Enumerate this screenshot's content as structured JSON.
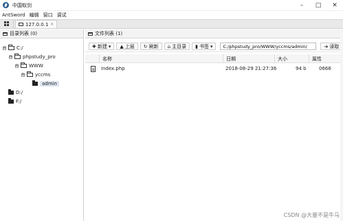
{
  "window": {
    "title": "中国蚁剑"
  },
  "menu": [
    "AntSword",
    "编辑",
    "窗口",
    "调试"
  ],
  "tabs": {
    "session_label": "127.0.0.1"
  },
  "left": {
    "header": "目录列表 (0)",
    "tree": [
      {
        "label": "C:/",
        "toggle": "⊟",
        "indent": 0
      },
      {
        "label": "phpstudy_pro",
        "toggle": "⊟",
        "indent": 1
      },
      {
        "label": "WWW",
        "toggle": "⊟",
        "indent": 2
      },
      {
        "label": "yccms",
        "toggle": "⊟",
        "indent": 3
      },
      {
        "label": "admin",
        "toggle": "",
        "indent": 4,
        "selected": true
      },
      {
        "label": "D:/",
        "toggle": "",
        "indent": 0
      },
      {
        "label": "F:/",
        "toggle": "",
        "indent": 0
      }
    ]
  },
  "right": {
    "header": "文件列表 (1)",
    "toolbar": {
      "new": "新建",
      "up": "上层",
      "refresh": "刷新",
      "home": "主目录",
      "bookmark": "书签",
      "path": "C:/phpstudy_pro/WWW/yccms/admin/",
      "read": "读取"
    },
    "columns": [
      "名称",
      "日期",
      "大小",
      "属性"
    ],
    "files": [
      {
        "name": "index.php",
        "date": "2018-08-29 21:27:36",
        "size": "94 b",
        "attr": "0666"
      }
    ]
  },
  "watermark": "CSDN @大量不是牛马"
}
